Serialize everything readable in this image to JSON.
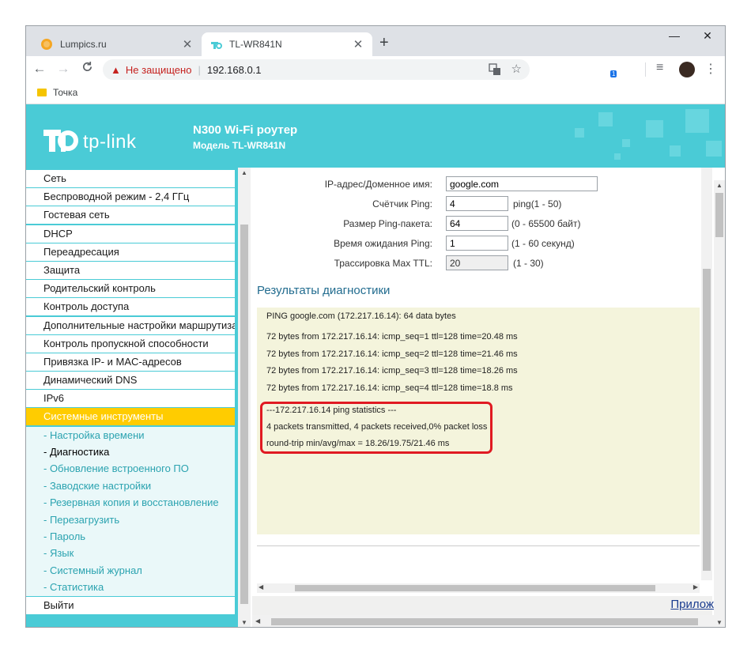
{
  "browser": {
    "tabs": [
      {
        "title": "Lumpics.ru",
        "active": false
      },
      {
        "title": "TL-WR841N",
        "active": true
      }
    ],
    "new_tab": "+",
    "window_controls": {
      "minimize": "—",
      "maximize": "☐",
      "close": "✕"
    },
    "nav": {
      "back": "←",
      "forward": "→",
      "reload": "C"
    },
    "security_label": "Не защищено",
    "url": "192.168.0.1",
    "star": "☆",
    "extensions": [
      {
        "name": "opera-icon",
        "color": "#e81123",
        "glyph": "O"
      },
      {
        "name": "music-extension-icon",
        "color": "#5aa02c",
        "glyph": "♫"
      },
      {
        "name": "vpn-globe-icon",
        "color": "#1a3fbf",
        "glyph": "◍"
      },
      {
        "name": "cube-extension-icon",
        "color": "#202124",
        "glyph": "◆"
      },
      {
        "name": "ab-extension-icon",
        "color": "#6b3fd4",
        "glyph": "ab"
      }
    ],
    "extension_badge": "1",
    "reading_list": "≡",
    "menu": "⋮",
    "bookmark": "Точка"
  },
  "router": {
    "brand": "tp-link",
    "title": "N300 Wi-Fi роутер",
    "model": "Модель TL-WR841N",
    "menu": [
      {
        "label": "Сеть"
      },
      {
        "label": "Беспроводной режим - 2,4 ГГц"
      },
      {
        "label": "Гостевая сеть"
      },
      {
        "label": "DHCP"
      },
      {
        "label": "Переадресация"
      },
      {
        "label": "Защита"
      },
      {
        "label": "Родительский контроль"
      },
      {
        "label": "Контроль доступа"
      },
      {
        "label": "Дополнительные настройки маршрутизации"
      },
      {
        "label": "Контроль пропускной способности"
      },
      {
        "label": "Привязка IP- и MAC-адресов"
      },
      {
        "label": "Динамический DNS"
      },
      {
        "label": "IPv6"
      }
    ],
    "selected_menu": "Системные инструменты",
    "submenu": [
      {
        "label": "- Настройка времени"
      },
      {
        "label": "- Диагностика"
      },
      {
        "label": "- Обновление встроенного ПО"
      },
      {
        "label": "- Заводские настройки"
      },
      {
        "label": "- Резервная копия и восстановление"
      },
      {
        "label": "- Перезагрузить"
      },
      {
        "label": "- Пароль"
      },
      {
        "label": "- Язык"
      },
      {
        "label": "- Системный журнал"
      },
      {
        "label": "- Статистика"
      }
    ],
    "logout": "Выйти",
    "form": {
      "ip_label": "IP-адрес/Доменное имя:",
      "ip_value": "google.com",
      "count_label": "Счётчик Ping:",
      "count_value": "4",
      "count_hint": "ping(1 - 50)",
      "size_label": "Размер Ping-пакета:",
      "size_value": "64",
      "size_hint": "(0 - 65500 байт)",
      "timeout_label": "Время ожидания Ping:",
      "timeout_value": "1",
      "timeout_hint": "(1 - 60 секунд)",
      "ttl_label": "Трассировка Max TTL:",
      "ttl_value": "20",
      "ttl_hint": "(1 - 30)"
    },
    "results_title": "Результаты диагностики",
    "results": [
      "PING google.com (172.217.16.14): 64 data bytes",
      "72 bytes from 172.217.16.14: icmp_seq=1 ttl=128 time=20.48 ms",
      "72 bytes from 172.217.16.14: icmp_seq=2 ttl=128 time=21.46 ms",
      "72 bytes from 172.217.16.14: icmp_seq=3 ttl=128 time=18.26 ms",
      "72 bytes from 172.217.16.14: icmp_seq=4 ttl=128 time=18.8 ms",
      "---172.217.16.14 ping statistics ---",
      "4 packets transmitted, 4 packets received,0% packet loss",
      "round-trip min/avg/max = 18.26/19.75/21.46 ms"
    ],
    "footer_link": "Прилож"
  },
  "colors": {
    "tplink_teal": "#4acbd6",
    "selected": "#ffcc00",
    "highlight": "#e01a22"
  }
}
